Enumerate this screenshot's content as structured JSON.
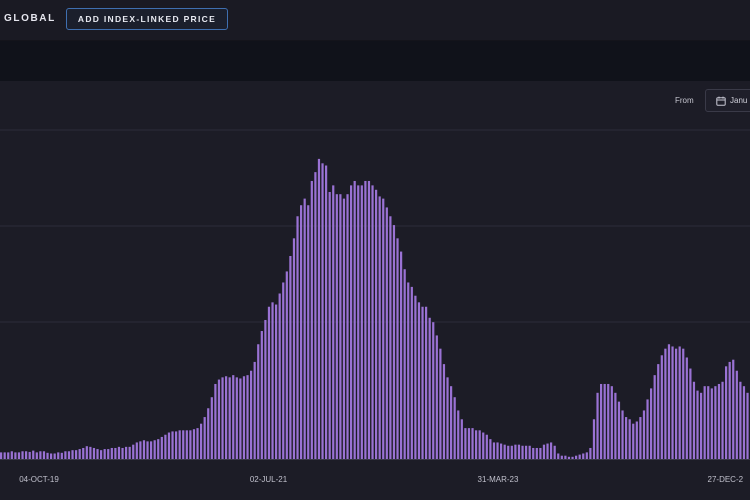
{
  "header": {
    "brand": "GLOBAL",
    "add_button_label": "ADD INDEX-LINKED PRICE"
  },
  "filters": {
    "from_label": "From",
    "from_value": "Janu",
    "calendar_icon": "calendar-icon"
  },
  "colors": {
    "bar": "#9a72d4",
    "background": "#1c1c26",
    "accent_border": "#3f6fb0"
  },
  "chart_data": {
    "type": "bar",
    "x_tick_labels": [
      "04-OCT-19",
      "02-JUL-21",
      "31-MAR-23",
      "27-DEC-2"
    ],
    "x_tick_positions": [
      0.052,
      0.358,
      0.664,
      0.967
    ],
    "grid": "horizontal",
    "series": [
      {
        "values": [
          3,
          3,
          3,
          3.5,
          3,
          3,
          3.5,
          3.5,
          3.2,
          3.8,
          3,
          3.5,
          3.5,
          2.8,
          2.5,
          2.5,
          3,
          2.8,
          3.5,
          3.5,
          4,
          4,
          4.5,
          5,
          5.8,
          5.5,
          5,
          4.5,
          4,
          4.5,
          4.5,
          5,
          5,
          5.5,
          5,
          5.5,
          5.5,
          6.5,
          7.5,
          8,
          8.5,
          8,
          8,
          8.5,
          9,
          10,
          11,
          12,
          12.5,
          12.5,
          13,
          13,
          13,
          13,
          13.5,
          14,
          16,
          19,
          23,
          28,
          34,
          36,
          37,
          37.5,
          37,
          38,
          37,
          36.5,
          37.5,
          38,
          40,
          44,
          52,
          58,
          63,
          69,
          71,
          70,
          75,
          80,
          85,
          92,
          100,
          110,
          115,
          118,
          115,
          126,
          130,
          136,
          134,
          133,
          121,
          124,
          120,
          120,
          118,
          120,
          124,
          126,
          124,
          124,
          126,
          126,
          124,
          122,
          119,
          118,
          114,
          110,
          106,
          100,
          94,
          86,
          80,
          78,
          74,
          71,
          69,
          69,
          64,
          62,
          56,
          50,
          43,
          37,
          33,
          28,
          22,
          18,
          14,
          14,
          14,
          13,
          13,
          12,
          11,
          9,
          7.5,
          7.5,
          7,
          6.5,
          6,
          6,
          6.5,
          6.5,
          6,
          6,
          6,
          5,
          5,
          5,
          6.5,
          7,
          7.5,
          6,
          2.5,
          1.5,
          1.5,
          1,
          1,
          1.5,
          2,
          2.5,
          3,
          5,
          18,
          30,
          34,
          34,
          34,
          33,
          30,
          26,
          22,
          19,
          18,
          16,
          17,
          19,
          22,
          27,
          32,
          38,
          43,
          47,
          50,
          52,
          51,
          50,
          51,
          50,
          46,
          41,
          35,
          31,
          30,
          33,
          33,
          32,
          33,
          34,
          35,
          42,
          44,
          45,
          40,
          35,
          33,
          30
        ]
      }
    ],
    "ylim": [
      0,
      150
    ]
  }
}
